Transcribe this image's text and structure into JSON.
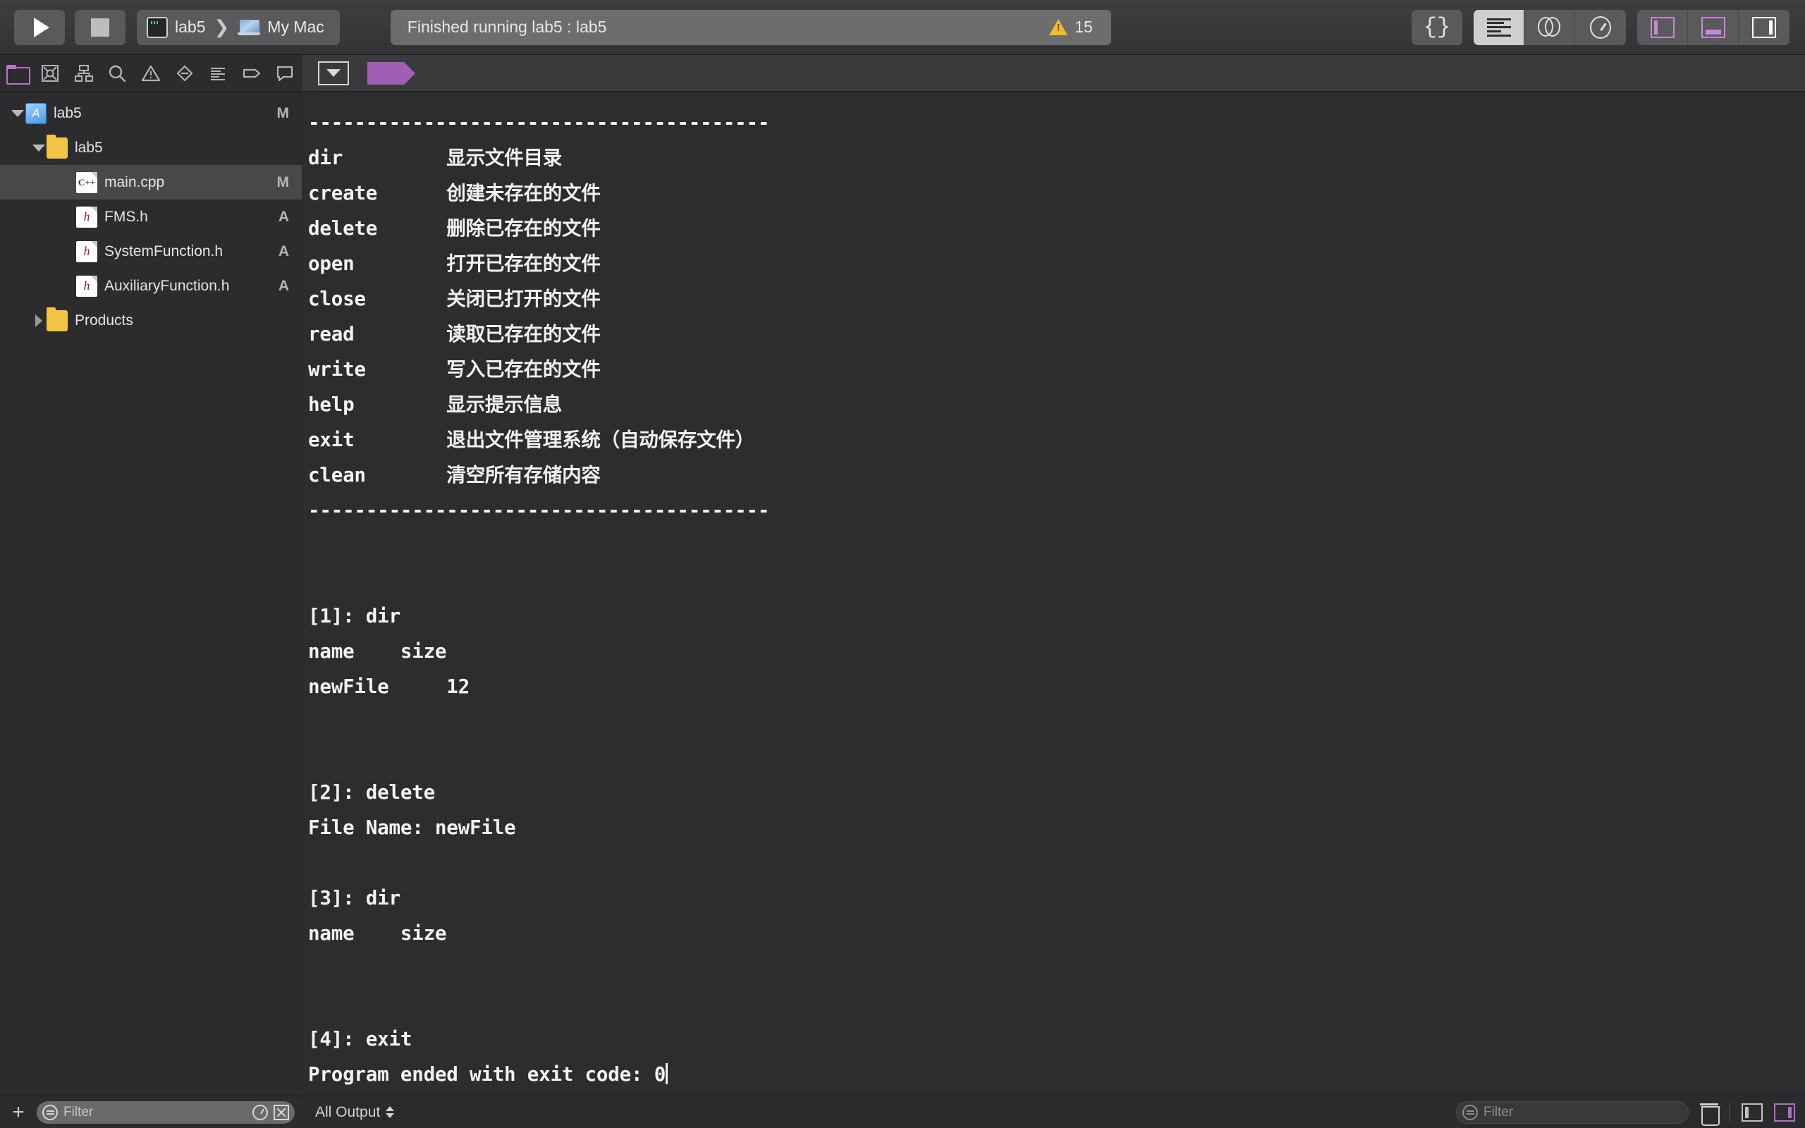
{
  "toolbar": {
    "run_label": "Run",
    "stop_label": "Stop",
    "scheme_name": "lab5",
    "scheme_separator": "❯",
    "destination_name": "My Mac",
    "status_text": "Finished running lab5 : lab5",
    "issue_count": "15",
    "library_label": "{}",
    "editor_standard_label": "standard-editor",
    "editor_assistant_label": "assistant-editor",
    "editor_version_label": "version-editor",
    "panel_left_label": "toggle-navigator",
    "panel_bottom_label": "toggle-debug-area",
    "panel_right_label": "toggle-inspector"
  },
  "navigator": {
    "tabs": [
      {
        "name": "project-navigator",
        "icon": "folder-icon",
        "active": true
      },
      {
        "name": "source-control-navigator",
        "icon": "source-control-icon",
        "active": false
      },
      {
        "name": "symbol-navigator",
        "icon": "hierarchy-icon",
        "active": false
      },
      {
        "name": "find-navigator",
        "icon": "search-icon",
        "active": false
      },
      {
        "name": "issue-navigator",
        "icon": "warning-triangle-icon",
        "active": false
      },
      {
        "name": "test-navigator",
        "icon": "diamond-minus-icon",
        "active": false
      },
      {
        "name": "debug-navigator",
        "icon": "list-lines-icon",
        "active": false
      },
      {
        "name": "breakpoint-navigator",
        "icon": "breakpoint-tag-icon",
        "active": false
      },
      {
        "name": "report-navigator",
        "icon": "speech-bubble-icon",
        "active": false
      }
    ],
    "tree": [
      {
        "label": "lab5",
        "icon": "xcode-project-icon",
        "indent": 0,
        "disclosure": "open",
        "flag": "M",
        "selected": false
      },
      {
        "label": "lab5",
        "icon": "folder-icon",
        "indent": 1,
        "disclosure": "open",
        "flag": "",
        "selected": false
      },
      {
        "label": "main.cpp",
        "icon": "cpp-file-icon",
        "indent": 2,
        "disclosure": "none",
        "flag": "M",
        "selected": true
      },
      {
        "label": "FMS.h",
        "icon": "header-file-icon",
        "indent": 2,
        "disclosure": "none",
        "flag": "A",
        "selected": false
      },
      {
        "label": "SystemFunction.h",
        "icon": "header-file-icon",
        "indent": 2,
        "disclosure": "none",
        "flag": "A",
        "selected": false
      },
      {
        "label": "AuxiliaryFunction.h",
        "icon": "header-file-icon",
        "indent": 2,
        "disclosure": "none",
        "flag": "A",
        "selected": false
      },
      {
        "label": "Products",
        "icon": "folder-icon",
        "indent": 1,
        "disclosure": "closed",
        "flag": "",
        "selected": false
      }
    ],
    "footer": {
      "add_label": "+",
      "filter_placeholder": "Filter",
      "recent_label": "recent-files-filter",
      "source_control_label": "source-control-filter"
    }
  },
  "jumpbar": {
    "related_items_label": "related-items",
    "breakpoint_label": "breakpoints-active"
  },
  "console": {
    "text": "----------------------------------------\ndir         显示文件目录\ncreate      创建未存在的文件\ndelete      删除已存在的文件\nopen        打开已存在的文件\nclose       关闭已打开的文件\nread        读取已存在的文件\nwrite       写入已存在的文件\nhelp        显示提示信息\nexit        退出文件管理系统（自动保存文件）\nclean       清空所有存储内容\n----------------------------------------\n\n\n[1]: dir\nname    size\nnewFile     12\n\n\n[2]: delete\nFile Name: newFile\n\n[3]: dir\nname    size\n\n\n[4]: exit\nProgram ended with exit code: 0",
    "commands": [
      {
        "index": "[1]",
        "command": "dir",
        "output": [
          "name    size",
          "newFile     12"
        ]
      },
      {
        "index": "[2]",
        "command": "delete",
        "output": [
          "File Name: newFile"
        ]
      },
      {
        "index": "[3]",
        "command": "dir",
        "output": [
          "name    size"
        ]
      },
      {
        "index": "[4]",
        "command": "exit",
        "output": [
          "Program ended with exit code: 0"
        ]
      }
    ],
    "help_commands": [
      {
        "name": "dir",
        "description": "显示文件目录"
      },
      {
        "name": "create",
        "description": "创建未存在的文件"
      },
      {
        "name": "delete",
        "description": "删除已存在的文件"
      },
      {
        "name": "open",
        "description": "打开已存在的文件"
      },
      {
        "name": "close",
        "description": "关闭已打开的文件"
      },
      {
        "name": "read",
        "description": "读取已存在的文件"
      },
      {
        "name": "write",
        "description": "写入已存在的文件"
      },
      {
        "name": "help",
        "description": "显示提示信息"
      },
      {
        "name": "exit",
        "description": "退出文件管理系统（自动保存文件）"
      },
      {
        "name": "clean",
        "description": "清空所有存储内容"
      }
    ],
    "separator": "----------------------------------------"
  },
  "bottom_bar": {
    "output_scope": "All Output",
    "filter_placeholder": "Filter",
    "trash_label": "clear-console",
    "variables_pane_label": "show-variables-view",
    "console_pane_label": "show-console-view"
  },
  "colors": {
    "accent_purple": "#b575c9",
    "warning_yellow": "#f0bd2a",
    "console_bg": "#2d2d30",
    "toolbar_bg": "#3a3a3c",
    "selection": "#48484a"
  }
}
